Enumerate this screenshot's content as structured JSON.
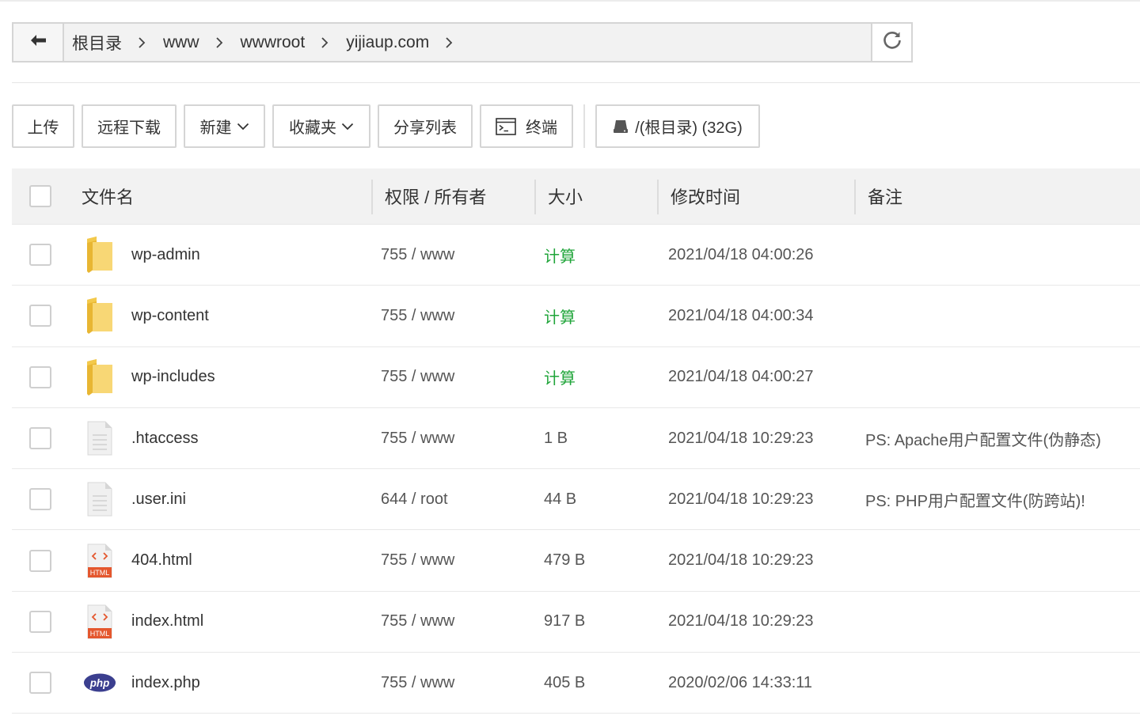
{
  "breadcrumb": {
    "items": [
      "根目录",
      "www",
      "wwwroot",
      "yijiaup.com"
    ]
  },
  "toolbar": {
    "upload": "上传",
    "remote_download": "远程下载",
    "new": "新建",
    "favorites": "收藏夹",
    "share_list": "分享列表",
    "terminal": "终端",
    "disk": "/(根目录) (32G)"
  },
  "table": {
    "headers": {
      "name": "文件名",
      "perm": "权限 / 所有者",
      "size": "大小",
      "mtime": "修改时间",
      "note": "备注"
    },
    "rows": [
      {
        "type": "folder",
        "name": "wp-admin",
        "perm": "755 / www",
        "size": "计算",
        "mtime": "2021/04/18 04:00:26",
        "note": ""
      },
      {
        "type": "folder",
        "name": "wp-content",
        "perm": "755 / www",
        "size": "计算",
        "mtime": "2021/04/18 04:00:34",
        "note": ""
      },
      {
        "type": "folder",
        "name": "wp-includes",
        "perm": "755 / www",
        "size": "计算",
        "mtime": "2021/04/18 04:00:27",
        "note": ""
      },
      {
        "type": "text",
        "name": ".htaccess",
        "perm": "755 / www",
        "size": "1 B",
        "mtime": "2021/04/18 10:29:23",
        "note": "PS: Apache用户配置文件(伪静态)"
      },
      {
        "type": "text",
        "name": ".user.ini",
        "perm": "644 / root",
        "size": "44 B",
        "mtime": "2021/04/18 10:29:23",
        "note": "PS: PHP用户配置文件(防跨站)!"
      },
      {
        "type": "html",
        "name": "404.html",
        "perm": "755 / www",
        "size": "479 B",
        "mtime": "2021/04/18 10:29:23",
        "note": ""
      },
      {
        "type": "html",
        "name": "index.html",
        "perm": "755 / www",
        "size": "917 B",
        "mtime": "2021/04/18 10:29:23",
        "note": ""
      },
      {
        "type": "php",
        "name": "index.php",
        "perm": "755 / www",
        "size": "405 B",
        "mtime": "2020/02/06 14:33:11",
        "note": ""
      }
    ]
  },
  "icons": {
    "html_badge": "HTML",
    "php_badge": "php"
  },
  "colors": {
    "calc_green": "#20a53a",
    "folder_yellow": "#f8d775",
    "html_orange": "#e4572e",
    "php_purple": "#3b3f8f"
  }
}
